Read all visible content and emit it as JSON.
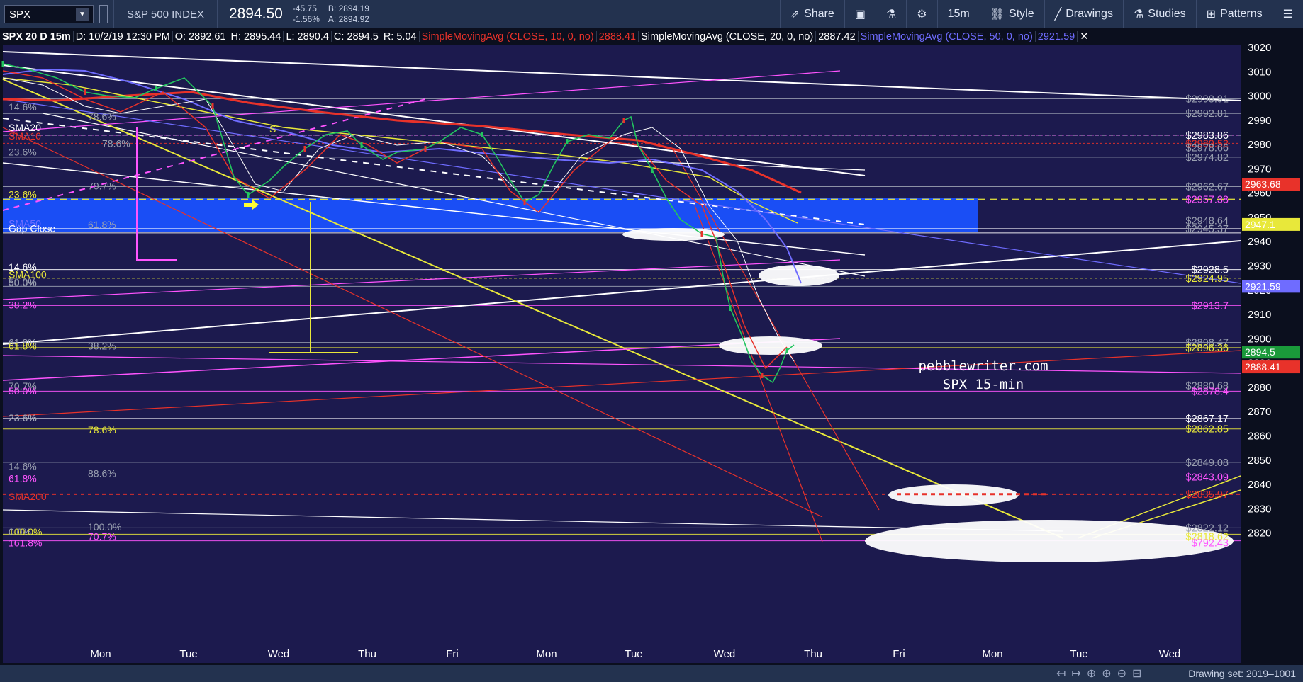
{
  "toolbar": {
    "symbol": "SPX",
    "instrument_name": "S&P 500 INDEX",
    "last_price": "2894.50",
    "net_change": "-45.75",
    "pct_change": "-1.56%",
    "bid": "B: 2894.19",
    "ask": "A: 2894.92",
    "buttons": [
      {
        "label": "Share",
        "icon": "share-icon"
      },
      {
        "label": "",
        "icon": "flexible-grid-icon"
      },
      {
        "label": "",
        "icon": "flask-icon"
      },
      {
        "label": "",
        "icon": "gear-icon"
      },
      {
        "label": "15m",
        "icon": ""
      },
      {
        "label": "Style",
        "icon": "style-icon"
      },
      {
        "label": "Drawings",
        "icon": "pencil-icon"
      },
      {
        "label": "Studies",
        "icon": "studies-icon"
      },
      {
        "label": "Patterns",
        "icon": "patterns-icon"
      },
      {
        "label": "",
        "icon": "menu-icon"
      }
    ]
  },
  "infobar": {
    "title": "SPX 20 D 15m",
    "date": "D: 10/2/19 12:30 PM",
    "open": "O: 2892.61",
    "high": "H: 2895.44",
    "low": "L: 2890.4",
    "close": "C: 2894.5",
    "range": "R: 5.04",
    "sma10_label": "SimpleMovingAvg (CLOSE, 10, 0, no)",
    "sma10_value": "2888.41",
    "sma20_label": "SimpleMovingAvg (CLOSE, 20, 0, no)",
    "sma20_value": "2887.42",
    "sma50_label": "SimpleMovingAvg (CLOSE, 50, 0, no)",
    "sma50_value": "2921.59",
    "colors": {
      "sma10": "#e8322a",
      "sma20": "#ffffff",
      "sma50": "#6f6cff"
    }
  },
  "watermark": [
    "pebblewriter.com",
    "SPX 15-min"
  ],
  "bottombar": {
    "drawing_set": "Drawing set: 2019–1001"
  },
  "chart_data": {
    "type": "line",
    "title": "SPX 20 D 15m",
    "x": [
      "Mon",
      "Tue",
      "Wed",
      "Thu",
      "Fri",
      "Mon",
      "Tue",
      "Wed",
      "Thu",
      "Fri",
      "Mon",
      "Tue",
      "Wed"
    ],
    "ylim": [
      2814,
      3024
    ],
    "y_ticks": [
      2820,
      2830,
      2840,
      2850,
      2860,
      2870,
      2880,
      2890,
      2900,
      2910,
      2920,
      2930,
      2940,
      2950,
      2960,
      2970,
      2980,
      2990,
      3000,
      3010,
      3020
    ],
    "series": [
      {
        "name": "SPX",
        "color": "#22c55e",
        "values_x_days": [
          0,
          0.3,
          0.6,
          0.9,
          1.0,
          1.3,
          1.6,
          1.9,
          2.0,
          2.3,
          2.6,
          2.9,
          3.0,
          3.3,
          3.6,
          3.9,
          4.0,
          4.3,
          4.6,
          4.9,
          5.0,
          5.3,
          5.6,
          5.9,
          6.0,
          6.3,
          6.6,
          6.9,
          7.0,
          7.2,
          7.4,
          7.6,
          7.8
        ],
        "values": [
          3014,
          3008,
          2998,
          2990,
          2994,
          2999,
          2988,
          2965,
          2958,
          2968,
          2975,
          2985,
          2979,
          2968,
          2974,
          2983,
          2985,
          2981,
          2957,
          2950,
          2960,
          2972,
          2981,
          2987,
          2988,
          2968,
          2955,
          2944,
          2947,
          2935,
          2910,
          2880,
          2894.5
        ]
      },
      {
        "name": "SMA10",
        "color": "#e8322a",
        "value": 2888.41
      },
      {
        "name": "SMA20",
        "color": "#ffffff",
        "value": 2887.42
      },
      {
        "name": "SMA50",
        "color": "#6f6cff",
        "value": 2921.59
      }
    ],
    "right_axis_badges": [
      {
        "value": "2963.68",
        "color": "#e8322a"
      },
      {
        "value": "2947.1",
        "color": "#e8e83a"
      },
      {
        "value": "2921.59",
        "color": "#6f6cff"
      },
      {
        "value": "2894.5",
        "color": "#1a9a3a"
      },
      {
        "value": "2888.41",
        "color": "#e8322a"
      }
    ],
    "level_labels_right": [
      {
        "text": "$2998.91",
        "value": 2998.91,
        "color": "#9aa0b0"
      },
      {
        "text": "$2992.81",
        "value": 2992.81,
        "color": "#9aa0b0"
      },
      {
        "text": "$2983.86",
        "value": 2983.86,
        "color": "#ffffff"
      },
      {
        "text": "$2980.52",
        "value": 2980.52,
        "color": "#e8322a"
      },
      {
        "text": "$2978.66",
        "value": 2978.66,
        "color": "#9aa0b0"
      },
      {
        "text": "$2974.82",
        "value": 2974.82,
        "color": "#9aa0b0"
      },
      {
        "text": "$2962.67",
        "value": 2962.67,
        "color": "#9aa0b0"
      },
      {
        "text": "$2957.38",
        "value": 2957.38,
        "color": "#ff55ff"
      },
      {
        "text": "$2948.64",
        "value": 2948.64,
        "color": "#9aa0b0"
      },
      {
        "text": "$2945.37",
        "value": 2945.37,
        "color": "#9aa0b0"
      },
      {
        "text": "$2928.5",
        "value": 2928.5,
        "color": "#ffffff"
      },
      {
        "text": "$2924.95",
        "value": 2924.95,
        "color": "#e8e83a"
      },
      {
        "text": "$2913.7",
        "value": 2913.7,
        "color": "#ff55ff"
      },
      {
        "text": "$2898.47",
        "value": 2898.47,
        "color": "#9aa0b0"
      },
      {
        "text": "$2896.36",
        "value": 2896.36,
        "color": "#e8e83a"
      },
      {
        "text": "$2880.68",
        "value": 2880.68,
        "color": "#9aa0b0"
      },
      {
        "text": "$2878.4",
        "value": 2878.4,
        "color": "#ff55ff"
      },
      {
        "text": "$2867.17",
        "value": 2867.17,
        "color": "#ffffff"
      },
      {
        "text": "$2862.85",
        "value": 2862.85,
        "color": "#e8e83a"
      },
      {
        "text": "$2849.08",
        "value": 2849.08,
        "color": "#9aa0b0"
      },
      {
        "text": "$2843.09",
        "value": 2843.09,
        "color": "#ff55ff"
      },
      {
        "text": "$2835.97",
        "value": 2835.97,
        "color": "#e8322a"
      },
      {
        "text": "$2822.12",
        "value": 2822.12,
        "color": "#9aa0b0"
      },
      {
        "text": "$2818.62",
        "value": 2818.62,
        "color": "#e8e83a"
      },
      {
        "text": "$792.43",
        "value": 2816,
        "color": "#ff55ff"
      }
    ],
    "level_labels_left": [
      {
        "text": "14.6%",
        "value": 2995.5,
        "color": "#9aa0b0"
      },
      {
        "text": "SMA20",
        "value": 2987,
        "color": "#ffffff"
      },
      {
        "text": "SMA10",
        "value": 2983.5,
        "color": "#e8322a"
      },
      {
        "text": "78.6%",
        "value": 2980.5,
        "color": "#9aa0b0"
      },
      {
        "text": "23.6%",
        "value": 2977,
        "color": "#9aa0b0"
      },
      {
        "text": "70.7%",
        "value": 2963,
        "color": "#9aa0b0"
      },
      {
        "text": "23.6%",
        "value": 2959.5,
        "color": "#e8e83a"
      },
      {
        "text": "SMA50",
        "value": 2947.5,
        "color": "#6f6cff"
      },
      {
        "text": "Gap Close",
        "value": 2945.5,
        "color": "#ffffff"
      },
      {
        "text": "61.8%",
        "value": 2947,
        "color": "#9aa0b0"
      },
      {
        "text": "14.6%",
        "value": 2929.5,
        "color": "#ffffff"
      },
      {
        "text": "SMA100",
        "value": 2926.5,
        "color": "#e8e83a"
      },
      {
        "text": "50.0%",
        "value": 2923.5,
        "color": "#9aa0b0"
      },
      {
        "text": "38.2%",
        "value": 2914,
        "color": "#ff55ff"
      },
      {
        "text": "61.8%",
        "value": 2898.5,
        "color": "#9aa0b0"
      },
      {
        "text": "61.8%",
        "value": 2897,
        "color": "#e8e83a"
      },
      {
        "text": "38.2%",
        "value": 2897,
        "color": "#9aa0b0"
      },
      {
        "text": "70.7%",
        "value": 2880.5,
        "color": "#9aa0b0"
      },
      {
        "text": "50.0%",
        "value": 2878.5,
        "color": "#ff55ff"
      },
      {
        "text": "23.6%",
        "value": 2867.5,
        "color": "#ffffff"
      },
      {
        "text": "23.6%",
        "value": 2867.5,
        "color": "#9aa0b0"
      },
      {
        "text": "78.6%",
        "value": 2862.5,
        "color": "#e8e83a"
      },
      {
        "text": "14.6%",
        "value": 2847.5,
        "color": "#9aa0b0"
      },
      {
        "text": "88.6%",
        "value": 2844.5,
        "color": "#9aa0b0"
      },
      {
        "text": "61.8%",
        "value": 2842.5,
        "color": "#ff55ff"
      },
      {
        "text": "SMA200",
        "value": 2835,
        "color": "#e8322a"
      },
      {
        "text": "100.0%",
        "value": 2822.5,
        "color": "#9aa0b0"
      },
      {
        "text": "100.0%",
        "value": 2820.5,
        "color": "#e8e83a"
      },
      {
        "text": "0.0%",
        "value": 2820.5,
        "color": "#9aa0b0"
      },
      {
        "text": "70.7%",
        "value": 2818.5,
        "color": "#ff55ff"
      },
      {
        "text": "161.8%",
        "value": 2816,
        "color": "#ff55ff"
      },
      {
        "text": "50.0%",
        "value": 2923,
        "color": "#9aa0b0"
      },
      {
        "text": "78.6%",
        "value": 2991.5,
        "color": "#9aa0b0"
      },
      {
        "text": "S",
        "value": 2986.5,
        "color": "#e8e83a"
      }
    ]
  }
}
